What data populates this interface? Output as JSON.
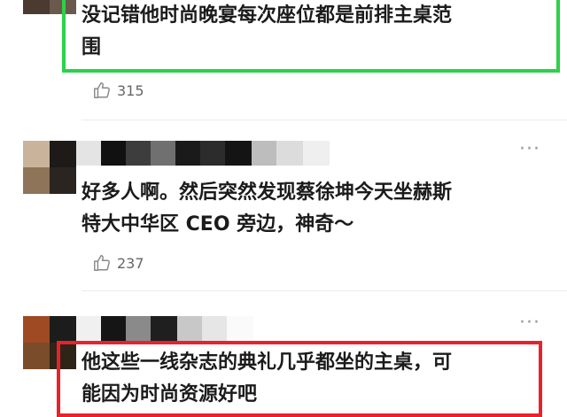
{
  "comments": [
    {
      "text_lines": [
        "没记错他时尚晚宴每次座位都是前排主桌范",
        "围"
      ],
      "likes": "315",
      "highlight": "green"
    },
    {
      "text_lines": [
        "好多人啊。然后突然发现蔡徐坤今天坐赫斯",
        "特大中华区 CEO 旁边，神奇～"
      ],
      "likes": "237",
      "more": "···"
    },
    {
      "text_lines": [
        "他这些一线杂志的典礼几乎都坐的主桌，可",
        "能因为时尚资源好吧"
      ],
      "more": "···",
      "highlight": "red"
    }
  ],
  "colors": {
    "highlight_green": "#2bd24a",
    "highlight_red": "#e8222a",
    "like_icon": "#8a8a8a"
  },
  "icons": [
    "thumbs-up-icon",
    "more-dots-icon"
  ]
}
